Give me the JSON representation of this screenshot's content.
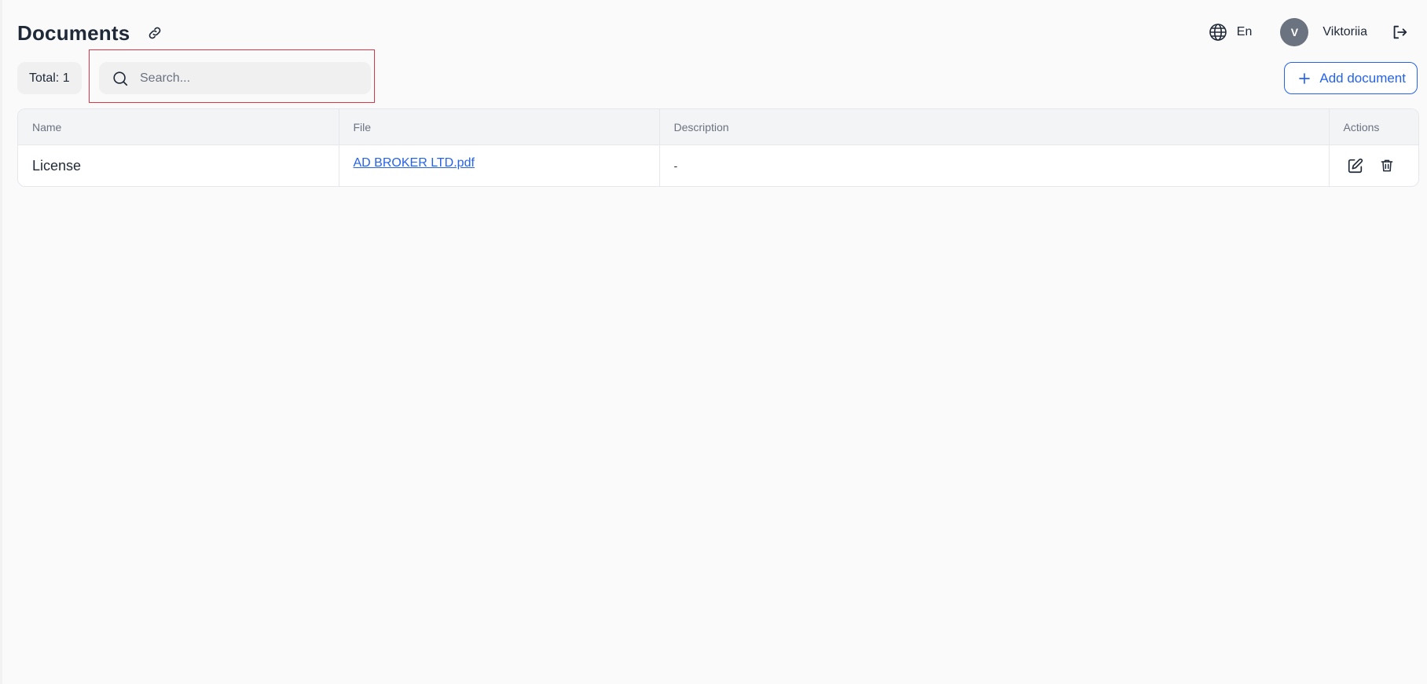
{
  "header": {
    "title": "Documents"
  },
  "user_bar": {
    "language": "En",
    "avatar_initial": "V",
    "user_name": "Viktoriia"
  },
  "toolbar": {
    "total_label": "Total: 1",
    "search_placeholder": "Search...",
    "search_value": "",
    "add_button_label": "Add document"
  },
  "table": {
    "columns": [
      "Name",
      "File",
      "Description",
      "Actions"
    ],
    "rows": [
      {
        "name": "License",
        "file": "AD BROKER LTD.pdf",
        "description": "-"
      }
    ]
  },
  "icons": {
    "link": "link-icon",
    "globe": "globe-icon",
    "logout": "logout-icon",
    "search": "search-icon",
    "add": "plus-icon",
    "edit": "edit-icon",
    "delete": "trash-icon"
  },
  "colors": {
    "accent": "#2563eb",
    "highlight": "#dc3545",
    "avatar_bg": "#6b7280"
  }
}
